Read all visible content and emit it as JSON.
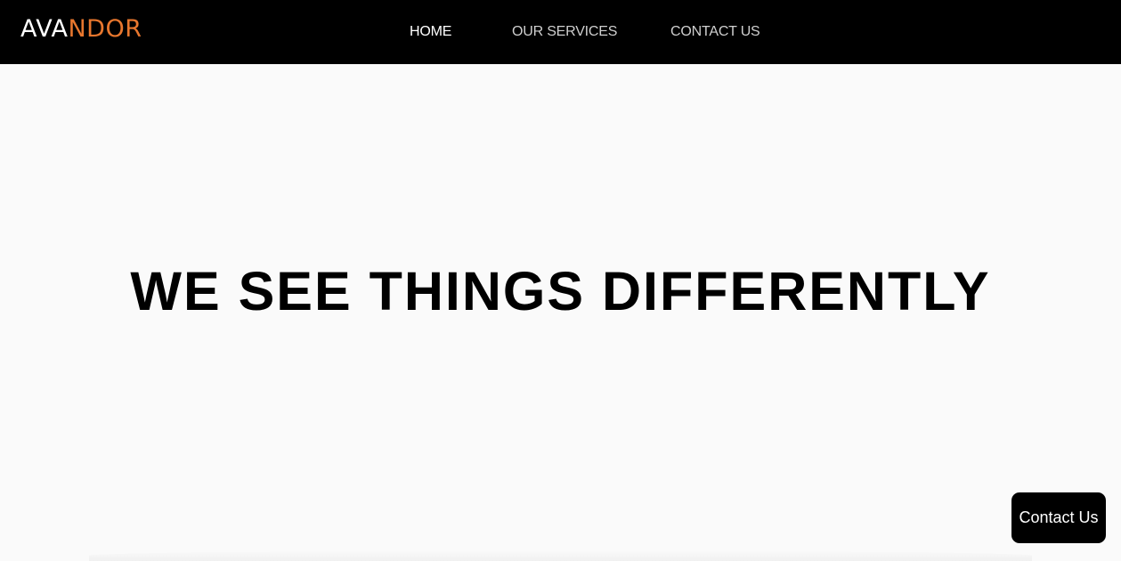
{
  "header": {
    "logo": {
      "part_white": "AVA",
      "part_orange": "NDOR",
      "white_color": "#ffffff",
      "accent_color": "#e8772e"
    },
    "nav": [
      {
        "label": "HOME",
        "active": true
      },
      {
        "label": "OUR SERVICES",
        "active": false
      },
      {
        "label": "CONTACT US",
        "active": false
      }
    ],
    "background_color": "#000000"
  },
  "hero": {
    "heading": "WE SEE THINGS DIFFERENTLY",
    "background_color": "#fafafa"
  },
  "floating_contact": {
    "label": "Contact Us"
  }
}
